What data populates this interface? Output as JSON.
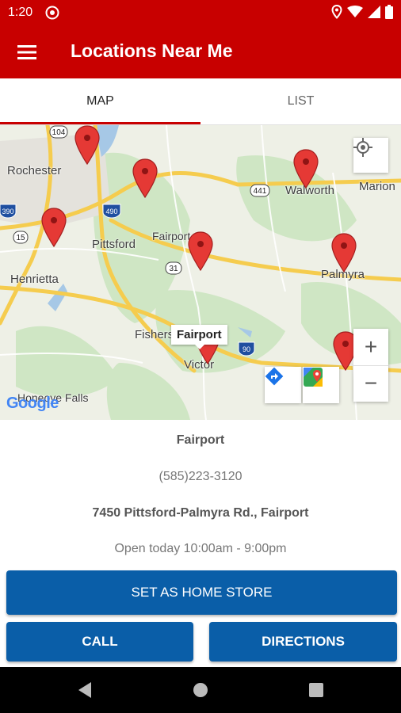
{
  "status_bar": {
    "time": "1:20"
  },
  "app_bar": {
    "title": "Locations Near Me"
  },
  "tabs": [
    {
      "label": "MAP",
      "active": true
    },
    {
      "label": "LIST",
      "active": false
    }
  ],
  "map": {
    "labels": {
      "rochester": "Rochester",
      "walworth": "Walworth",
      "marion": "Marion",
      "pittsford": "Pittsford",
      "fairport": "Fairport",
      "henrietta": "Henrietta",
      "palmyra": "Palmyra",
      "fishers": "Fishers",
      "victor": "Victor",
      "honeoye_falls": "Honeoye Falls"
    },
    "road_shields": {
      "r104": "104",
      "r441": "441",
      "r490": "490",
      "r390": "390",
      "r15": "15",
      "r31": "31",
      "r90": "90"
    },
    "callout": "Fairport",
    "google_logo": "Google",
    "zoom_in": "+",
    "zoom_out": "−"
  },
  "store": {
    "name": "Fairport",
    "phone": "(585)223-3120",
    "address": "7450 Pittsford-Palmyra Rd., Fairport",
    "hours": "Open today 10:00am - 9:00pm"
  },
  "buttons": {
    "home": "SET AS HOME STORE",
    "call": "CALL",
    "directions": "DIRECTIONS"
  },
  "colors": {
    "brand_red": "#c80000",
    "button_blue": "#0a5ea8",
    "pin_red": "#e53935"
  }
}
